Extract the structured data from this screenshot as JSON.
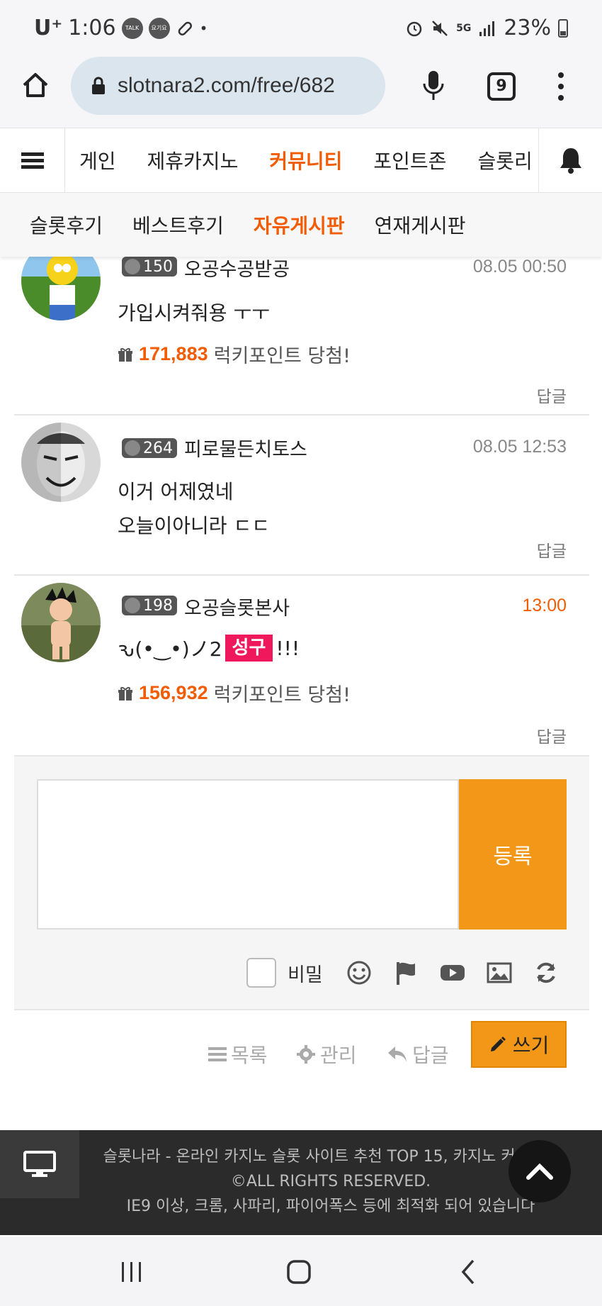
{
  "status_bar": {
    "carrier": "U⁺",
    "time": "1:06",
    "notif_talk": "TALK",
    "notif_yogiyo": "요기요",
    "battery": "23%",
    "network": "5G"
  },
  "browser": {
    "url": "slotnara2.com/free/682",
    "tab_count": "9"
  },
  "site_nav": {
    "items": [
      {
        "label": "게인"
      },
      {
        "label": "제휴카지노"
      },
      {
        "label": "커뮤니티"
      },
      {
        "label": "포인트존"
      },
      {
        "label": "슬롯리"
      }
    ]
  },
  "sub_nav": {
    "items": [
      {
        "label": "슬롯후기"
      },
      {
        "label": "베스트후기"
      },
      {
        "label": "자유게시판"
      },
      {
        "label": "연재게시판"
      }
    ]
  },
  "comments": [
    {
      "level": "150",
      "author": "오공수공받공",
      "date": "08.05 00:50",
      "text_lines": [
        "가입시켜줘용 ㅜㅜ"
      ],
      "lucky_points": "171,883",
      "lucky_label": "럭키포인트 당첨!",
      "reply": "답글"
    },
    {
      "level": "264",
      "author": "피로물든치토스",
      "date": "08.05 12:53",
      "text_lines": [
        "이거 어제였네",
        "오늘이아니라 ㄷㄷ"
      ],
      "reply": "답글"
    },
    {
      "level": "198",
      "author": "오공슬롯본사",
      "date": "13:00",
      "text_prefix": "ԅ(•‿•)ノ2",
      "text_tag": "성구",
      "text_suffix": "!!!",
      "lucky_points": "156,932",
      "lucky_label": "럭키포인트 당첨!",
      "reply": "답글"
    }
  ],
  "reply_form": {
    "textarea_placeholder": "",
    "submit_label": "등록",
    "secret_label": "비밀"
  },
  "actions": {
    "list_label": "목록",
    "manage_label": "관리",
    "reply_label": "답글",
    "write_label": "쓰기"
  },
  "footer": {
    "line1": "슬롯나라 - 온라인 카지노 슬롯 사이트 추천 TOP 15, 카지노 커뮤니티 ©ALL RIGHTS RESERVED.",
    "line2": "IE9 이상, 크롬, 사파리, 파이어폭스 등에 최적화 되어 있습니다"
  },
  "colors": {
    "accent": "#f25c05",
    "button": "#f39718",
    "tag": "#f0185c",
    "footer_bg": "#2b2b2b"
  }
}
